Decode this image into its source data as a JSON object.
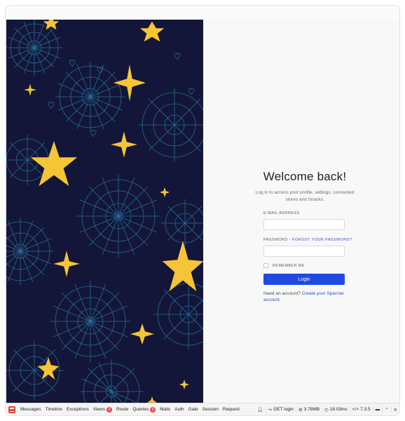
{
  "auth": {
    "title": "Welcome back!",
    "subtitle": "Log in to access your profile, settings, connected stores and Snacks.",
    "email_label": "E-mail address",
    "password_label": "Password",
    "password_separator": " - ",
    "forgot_password": "Forgot your password?",
    "remember_label": "Remember me",
    "login_button": "Login",
    "no_account": "Need an account?",
    "create_account": "Create your Sparrow account."
  },
  "debugbar": {
    "tabs": [
      {
        "label": "Messages"
      },
      {
        "label": "Timeline"
      },
      {
        "label": "Exceptions"
      },
      {
        "label": "Views",
        "badge": "2"
      },
      {
        "label": "Route"
      },
      {
        "label": "Queries",
        "badge": "0"
      },
      {
        "label": "Mails"
      },
      {
        "label": "Auth"
      },
      {
        "label": "Gate"
      },
      {
        "label": "Session"
      },
      {
        "label": "Request"
      }
    ],
    "request": "GET login",
    "memory": "3.78MB",
    "time": "18.03ms",
    "version": "7.3.5"
  },
  "colors": {
    "art_background": "#131638",
    "star": "#f6c437",
    "snowflake": "#2b7aa8",
    "accent": "#2049e0",
    "link": "#2d4fc4"
  },
  "icons": {
    "logo": "debugbar-logo-icon",
    "user": "user-icon",
    "route": "share-icon",
    "memory": "cogs-icon",
    "time": "clock-icon",
    "version": "code-icon",
    "open": "folder-open-icon",
    "restore": "chevron-up-icon",
    "close": "close-icon"
  }
}
